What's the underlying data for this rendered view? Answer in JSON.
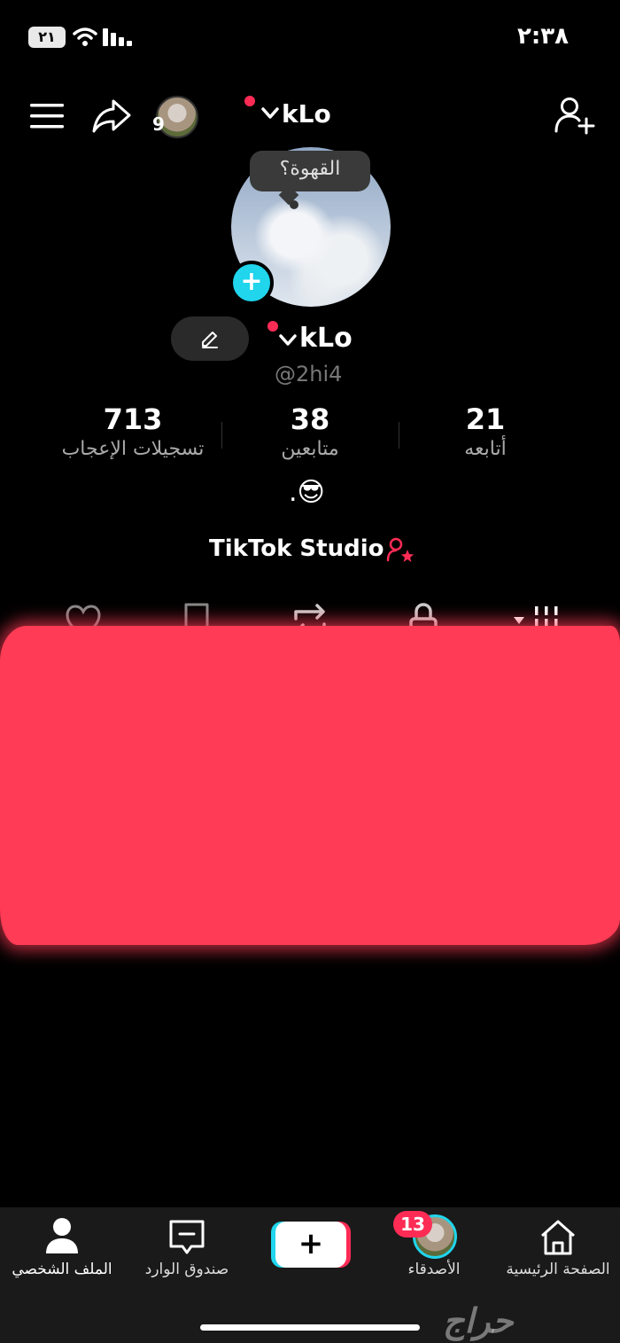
{
  "status_bar": {
    "battery": "٢١",
    "time": "٢:٣٨"
  },
  "header": {
    "username": "kLo",
    "friends_count": "9"
  },
  "profile": {
    "note": "القهوة؟",
    "username": "kLo",
    "handle": "@2hi4",
    "stats": [
      {
        "value": "713",
        "label": "تسجيلات الإعجاب"
      },
      {
        "value": "38",
        "label": "متابعين"
      },
      {
        "value": "21",
        "label": "أتابعه"
      }
    ],
    "bio": ".😎",
    "studio_link": "TikTok Studio"
  },
  "tabs": [
    "liked",
    "favorites",
    "reposts",
    "private",
    "videos"
  ],
  "bottom_nav": {
    "home": "الصفحة الرئيسية",
    "friends": "الأصدقاء",
    "friends_badge": "13",
    "create": "+",
    "inbox": "صندوق الوارد",
    "profile": "الملف الشخصي"
  },
  "watermark": "حراج",
  "colors": {
    "accent": "#fe2c55",
    "cyan": "#20d5ec",
    "background": "#000000"
  }
}
